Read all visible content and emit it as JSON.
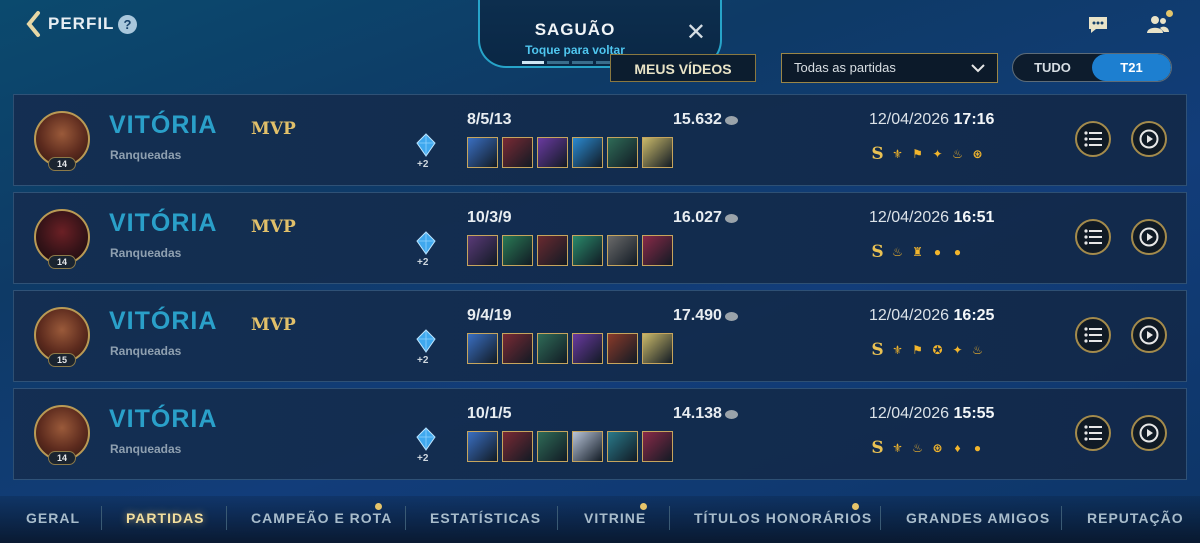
{
  "header": {
    "back_label": "PERFIL",
    "help_symbol": "?",
    "lobby_title": "SAGUÃO",
    "lobby_subtitle": "Toque para voltar",
    "lobby_close": "✕"
  },
  "toolbar": {
    "videos_label": "MEUS VÍDEOS",
    "filter_value": "Todas as partidas",
    "season_options": [
      "TUDO",
      "T21"
    ],
    "season_selected": "T21"
  },
  "matches": [
    {
      "result": "VITÓRIA",
      "mode": "Ranqueadas",
      "mvp": "MVP",
      "level": "14",
      "extra": "+2",
      "kda": "8/5/13",
      "gold": "15.632",
      "date": "12/04/2026",
      "time": "17:16",
      "items": [
        "#3a6fc2",
        "#7a2a34",
        "#6a3aa0",
        "#2b8ad0",
        "#2f6b57",
        "#c9b96a"
      ],
      "badges": [
        "S",
        "⚜",
        "⚑",
        "✦",
        "♨",
        "⊛"
      ]
    },
    {
      "result": "VITÓRIA",
      "mode": "Ranqueadas",
      "mvp": "MVP",
      "level": "14",
      "extra": "+2",
      "kda": "10/3/9",
      "gold": "16.027",
      "date": "12/04/2026",
      "time": "16:51",
      "items": [
        "#5a3a78",
        "#2a7a55",
        "#6a2a30",
        "#2a8a6a",
        "#6a6a6a",
        "#8a2a48"
      ],
      "badges": [
        "S",
        "♨",
        "♜",
        "●",
        "●"
      ]
    },
    {
      "result": "VITÓRIA",
      "mode": "Ranqueadas",
      "mvp": "MVP",
      "level": "15",
      "extra": "+2",
      "kda": "9/4/19",
      "gold": "17.490",
      "date": "12/04/2026",
      "time": "16:25",
      "items": [
        "#3a6fc2",
        "#7a2a34",
        "#2f6b57",
        "#6a3aa0",
        "#8a3a2a",
        "#c9b96a"
      ],
      "badges": [
        "S",
        "⚜",
        "⚑",
        "✪",
        "✦",
        "♨"
      ]
    },
    {
      "result": "VITÓRIA",
      "mode": "Ranqueadas",
      "mvp": "",
      "level": "14",
      "extra": "+2",
      "kda": "10/1/5",
      "gold": "14.138",
      "date": "12/04/2026",
      "time": "15:55",
      "items": [
        "#3a6fc2",
        "#7a2a34",
        "#2f6b57",
        "#b8c4d8",
        "#2a7a8a",
        "#8a2a48"
      ],
      "badges": [
        "S",
        "⚜",
        "♨",
        "⊛",
        "♦",
        "●"
      ]
    }
  ],
  "tabs": [
    "GERAL",
    "PARTIDAS",
    "CAMPEÃO E ROTA",
    "ESTATÍSTICAS",
    "VITRINE",
    "TÍTULOS HONORÁRIOS",
    "GRANDES AMIGOS",
    "REPUTAÇÃO"
  ],
  "active_tab": "PARTIDAS",
  "colors": {
    "accent_gold": "#e1c06a",
    "victory": "#2aa0c9",
    "active_toggle": "#1d7fd0"
  }
}
